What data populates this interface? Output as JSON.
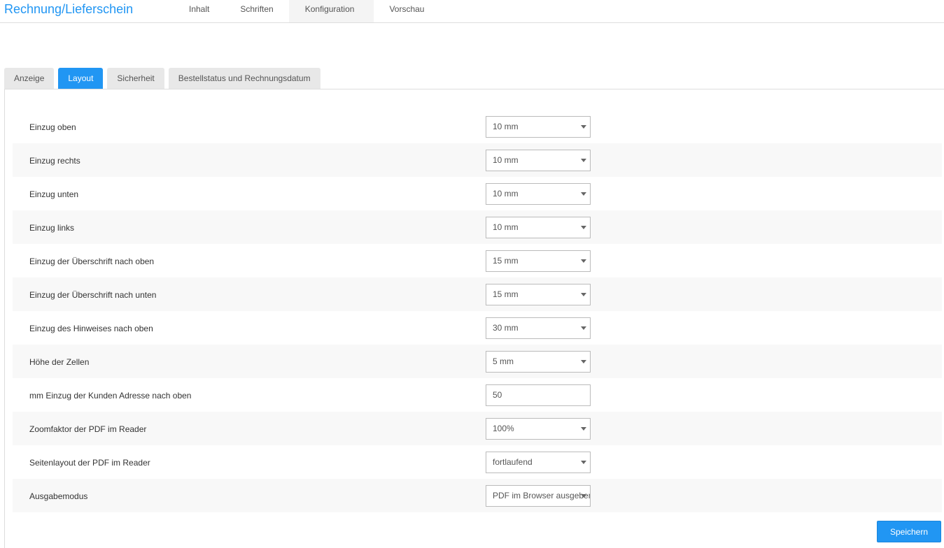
{
  "header": {
    "title": "Rechnung/Lieferschein",
    "nav": [
      "Inhalt",
      "Schriften",
      "Konfiguration",
      "Vorschau"
    ],
    "active_nav": "Konfiguration"
  },
  "tabs": [
    "Anzeige",
    "Layout",
    "Sicherheit",
    "Bestellstatus und Rechnungsdatum"
  ],
  "active_tab": "Layout",
  "rows": [
    {
      "label": "Einzug oben",
      "value": "10 mm",
      "type": "select"
    },
    {
      "label": "Einzug rechts",
      "value": "10 mm",
      "type": "select"
    },
    {
      "label": "Einzug unten",
      "value": "10 mm",
      "type": "select"
    },
    {
      "label": "Einzug links",
      "value": "10 mm",
      "type": "select"
    },
    {
      "label": "Einzug der Überschrift nach oben",
      "value": "15 mm",
      "type": "select"
    },
    {
      "label": "Einzug der Überschrift nach unten",
      "value": "15 mm",
      "type": "select"
    },
    {
      "label": "Einzug des Hinweises nach oben",
      "value": "30 mm",
      "type": "select"
    },
    {
      "label": "Höhe der Zellen",
      "value": "5 mm",
      "type": "select"
    },
    {
      "label": "mm Einzug der Kunden Adresse nach oben",
      "value": "50",
      "type": "input"
    },
    {
      "label": "Zoomfaktor der PDF im Reader",
      "value": "100%",
      "type": "select"
    },
    {
      "label": "Seitenlayout der PDF im Reader",
      "value": "fortlaufend",
      "type": "select"
    },
    {
      "label": "Ausgabemodus",
      "value": "PDF im Browser ausgeben",
      "type": "select"
    }
  ],
  "save_label": "Speichern",
  "colors": {
    "accent": "#2196f3"
  }
}
